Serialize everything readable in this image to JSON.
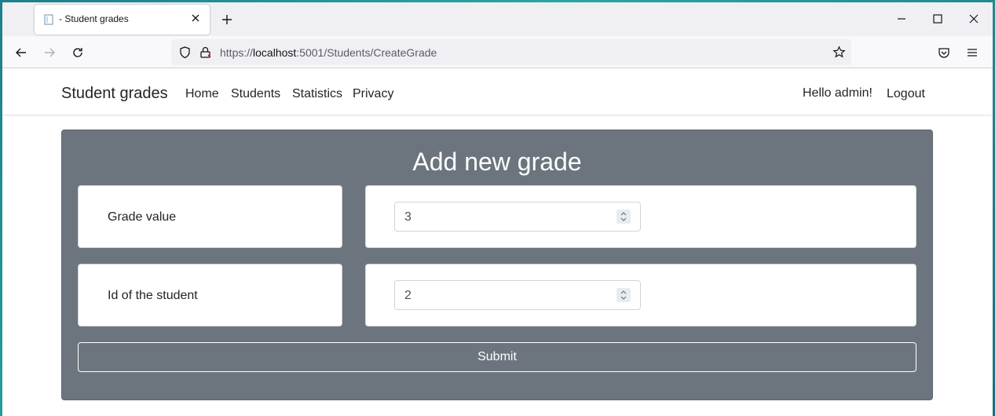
{
  "browser": {
    "tab_title": "- Student grades",
    "url_prefix": "https://",
    "url_host": "localhost",
    "url_path": ":5001/Students/CreateGrade"
  },
  "site": {
    "brand": "Student grades",
    "nav": [
      "Home",
      "Students",
      "Statistics",
      "Privacy"
    ],
    "greeting": "Hello admin!",
    "logout": "Logout"
  },
  "form": {
    "title": "Add new grade",
    "grade_label": "Grade value",
    "grade_value": "3",
    "student_label": "Id of the student",
    "student_value": "2",
    "submit": "Submit"
  },
  "colors": {
    "card_bg": "#6c757d",
    "desktop_bg": "#2aa6a0"
  },
  "icons": [
    "page-icon",
    "close-icon",
    "plus-icon",
    "minimize-icon",
    "maximize-icon",
    "back-icon",
    "forward-icon",
    "reload-icon",
    "shield-icon",
    "lock-icon",
    "star-icon",
    "pocket-icon",
    "menu-icon",
    "spinner-icon"
  ]
}
